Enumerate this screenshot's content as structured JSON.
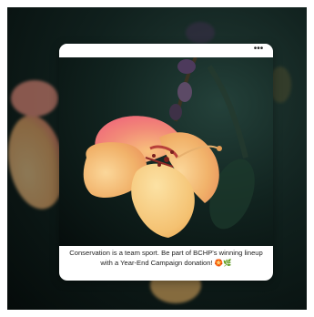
{
  "card": {
    "menu_label": "•••",
    "caption": "Conservation is a team sport. Be part of BCHP's winning lineup with a Year-End Campaign donation! 🏵️🌿"
  },
  "colors": {
    "petal_main": "#f1b26a",
    "petal_tip": "#ef5d7a",
    "background_dark": "#0b1614",
    "card_background": "#ffffff"
  },
  "icons": {
    "menu": "more-horizontal-icon"
  }
}
